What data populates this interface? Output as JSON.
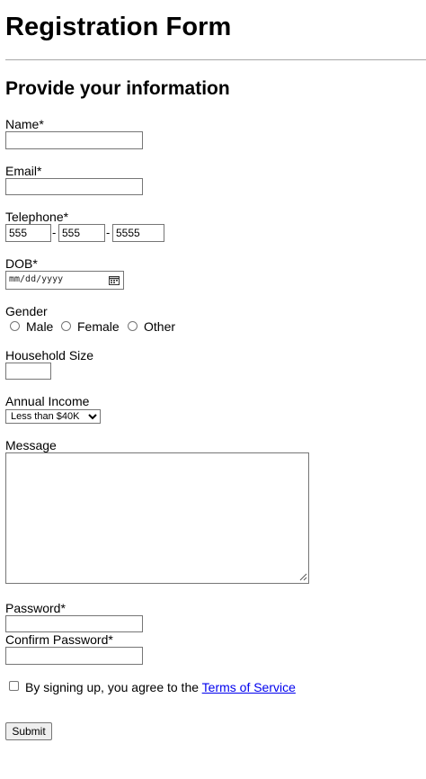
{
  "page": {
    "title": "Registration Form",
    "subtitle": "Provide your information"
  },
  "form": {
    "name_label": "Name*",
    "name_value": "",
    "email_label": "Email*",
    "email_value": "",
    "telephone_label": "Telephone*",
    "telephone_parts": [
      "555",
      "555",
      "5555"
    ],
    "telephone_separator": "-",
    "dob_label": "DOB*",
    "dob_placeholder": "mm/dd/yyyy",
    "dob_icon": "calendar-icon",
    "gender_label": "Gender",
    "gender_options": [
      "Male",
      "Female",
      "Other"
    ],
    "household_label": "Household Size",
    "household_value": "",
    "income_label": "Annual Income",
    "income_selected": "Less than $40K",
    "message_label": "Message",
    "message_value": "",
    "password_label": "Password*",
    "confirm_password_label": "Confirm Password*",
    "agree_text": "By signing up, you agree to the ",
    "terms_link": "Terms of Service",
    "submit_label": "Submit"
  }
}
